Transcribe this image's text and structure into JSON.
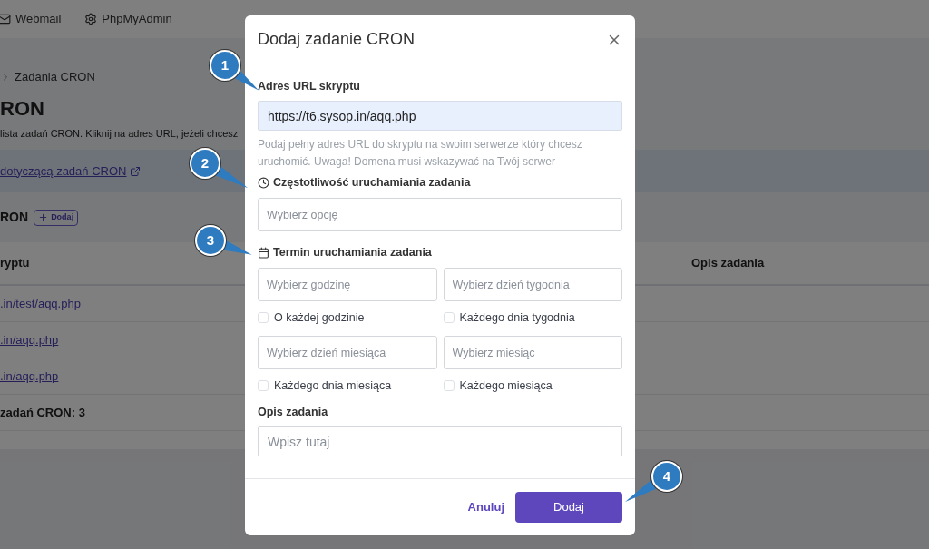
{
  "nav": {
    "items": [
      {
        "kind": "mail",
        "label": "Webmail"
      },
      {
        "kind": "settings",
        "label": "PhpMyAdmin"
      }
    ]
  },
  "page": {
    "breadcrumb": "Zadania CRON",
    "heading": "RON",
    "description": "lista zadań CRON. Kliknij na adres URL, jeżeli chcesz",
    "info_link": "dotyczącą zadań CRON",
    "section_title": "RON",
    "add_button": "Dodaj",
    "table": {
      "columns": [
        "ryptu",
        "Opis zadania"
      ],
      "rows": [
        {
          "url": ".in/test/aqq.php"
        },
        {
          "url": ".in/aqq.php"
        },
        {
          "url": ".in/aqq.php"
        }
      ],
      "footer": "zadań CRON: 3"
    }
  },
  "dialog": {
    "title": "Dodaj zadanie CRON",
    "url_label": "Adres URL skryptu",
    "url_value": "https://t6.sysop.in/aqq.php",
    "url_hint": "Podaj pełny adres URL do skryptu na swoim serwerze który chcesz uruchomić. Uwaga! Domena musi wskazywać na Twój serwer",
    "frequency_label": "Częstotliwość uruchamiania zadania",
    "frequency_placeholder": "Wybierz opcję",
    "schedule_label": "Termin uruchamiania zadania",
    "schedule_rows": [
      {
        "fields": [
          {
            "placeholder": "Wybierz godzinę"
          },
          {
            "placeholder": "Wybierz dzień tygodnia"
          }
        ],
        "options": [
          {
            "label": "O każdej godzinie",
            "checked": false
          },
          {
            "label": "Każdego dnia tygodnia",
            "checked": false
          }
        ]
      },
      {
        "fields": [
          {
            "placeholder": "Wybierz dzień miesiąca"
          },
          {
            "placeholder": "Wybierz miesiąc"
          }
        ],
        "options": [
          {
            "label": "Każdego dnia miesiąca",
            "checked": false
          },
          {
            "label": "Każdego miesiąca",
            "checked": false
          }
        ]
      }
    ],
    "description_label": "Opis zadania",
    "description_placeholder": "Wpisz tutaj",
    "buttons": {
      "cancel": "Anuluj",
      "submit": "Dodaj"
    }
  },
  "callouts": [
    {
      "label": "1"
    },
    {
      "label": "2"
    },
    {
      "label": "3"
    },
    {
      "label": "4"
    }
  ]
}
